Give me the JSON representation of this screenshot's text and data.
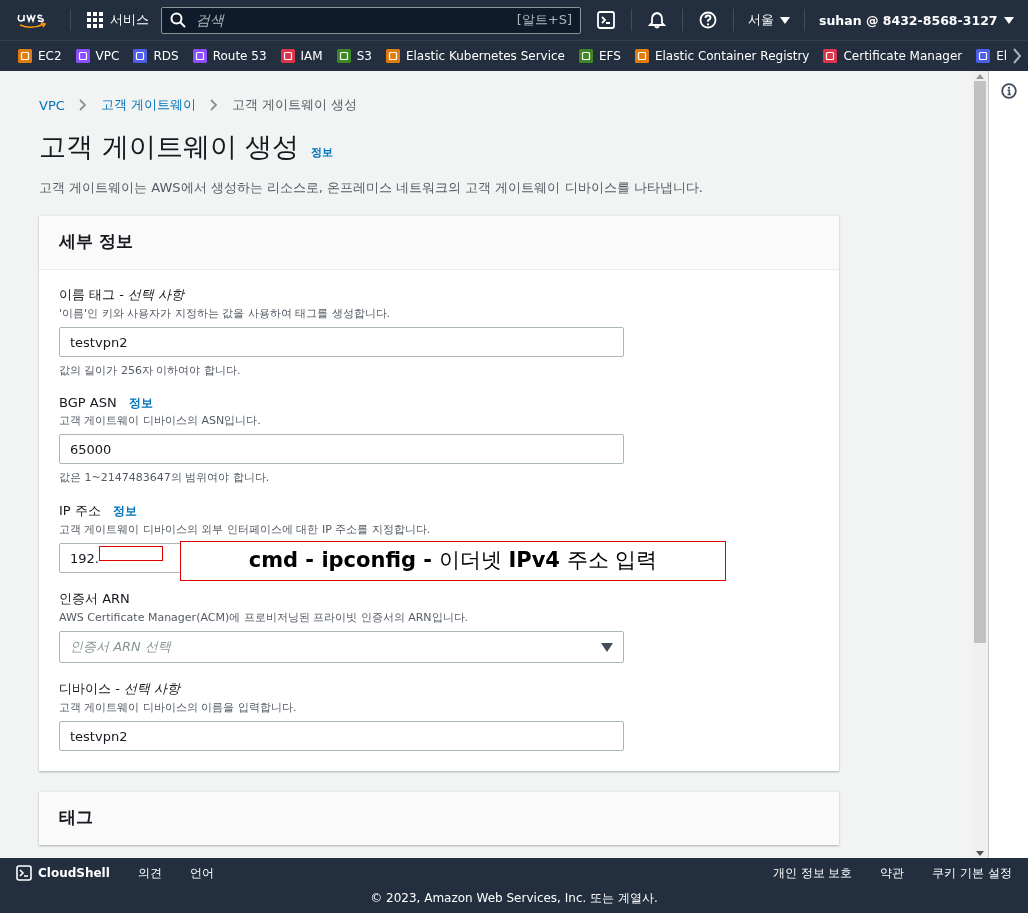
{
  "top_nav": {
    "services": "서비스",
    "search": {
      "placeholder": "검색",
      "shortcut": "[알트+S]"
    },
    "region": "서울",
    "account": "suhan @ 8432-8568-3127"
  },
  "favorites": [
    {
      "label": "EC2",
      "color": "#e07b12"
    },
    {
      "label": "VPC",
      "color": "#8c4fff"
    },
    {
      "label": "RDS",
      "color": "#4d5ee8"
    },
    {
      "label": "Route 53",
      "color": "#8c4fff"
    },
    {
      "label": "IAM",
      "color": "#dd344c"
    },
    {
      "label": "S3",
      "color": "#3f8624"
    },
    {
      "label": "Elastic Kubernetes Service",
      "color": "#e07b12"
    },
    {
      "label": "EFS",
      "color": "#3f8624"
    },
    {
      "label": "Elastic Container Registry",
      "color": "#e07b12"
    },
    {
      "label": "Certificate Manager",
      "color": "#dd344c"
    },
    {
      "label": "El",
      "color": "#4d5ee8"
    }
  ],
  "breadcrumbs": [
    {
      "label": "VPC",
      "link": true
    },
    {
      "label": "고객 게이트웨이",
      "link": true
    },
    {
      "label": "고객 게이트웨이 생성",
      "link": false
    }
  ],
  "page": {
    "title": "고객 게이트웨이 생성",
    "info": "정보",
    "description": "고객 게이트웨이는 AWS에서 생성하는 리소스로, 온프레미스 네트워크의 고객 게이트웨이 디바이스를 나타냅니다."
  },
  "details": {
    "title": "세부 정보",
    "fields": [
      {
        "kind": "input",
        "label": "이름 태그 - ",
        "optional": "선택 사항",
        "description": "'이름'인 키와 사용자가 지정하는 값을 사용하여 태그를 생성합니다.",
        "value": "testvpn2",
        "hint": "값의 길이가 256자 이하여야 합니다."
      },
      {
        "kind": "input",
        "label": "BGP ASN",
        "info": "정보",
        "description": "고객 게이트웨이 디바이스의 ASN입니다.",
        "value": "65000",
        "hint": "값은 1~2147483647의 범위여야 합니다."
      },
      {
        "kind": "input",
        "label": "IP 주소",
        "info": "정보",
        "description": "고객 게이트웨이 디바이스의 외부 인터페이스에 대한 IP 주소를 지정합니다.",
        "value": "192.",
        "redacted": true
      },
      {
        "kind": "select",
        "label": "인증서 ARN",
        "description": "AWS Certificate Manager(ACM)에 프로비저닝된 프라이빗 인증서의 ARN입니다.",
        "placeholder": "인증서 ARN 선택"
      },
      {
        "kind": "input",
        "label": "디바이스 - ",
        "optional": "선택 사항",
        "description": "고객 게이트웨이 디바이스의 이름을 입력합니다.",
        "value": "testvpn2"
      }
    ]
  },
  "annotation": "**cmd - ipconfig  -** 이더넷 **IPv4** 주소 입력",
  "tags": {
    "title": "태그"
  },
  "footer": {
    "cloudshell": "CloudShell",
    "links": [
      "의견",
      "언어"
    ],
    "right_links": [
      "개인 정보 보호",
      "약관",
      "쿠키 기본 설정"
    ],
    "copyright": "© 2023, Amazon Web Services, Inc. 또는 계열사."
  }
}
